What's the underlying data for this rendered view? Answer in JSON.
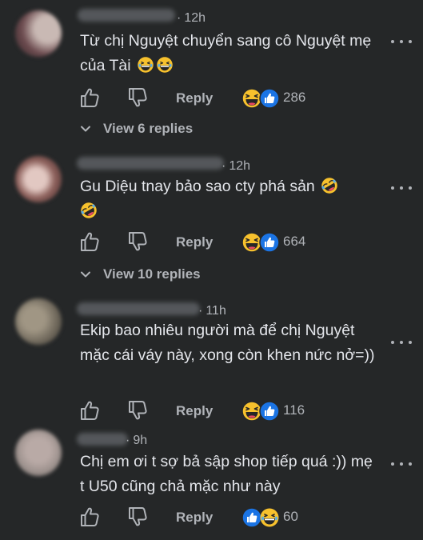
{
  "comments": [
    {
      "time": "12h",
      "text": "Từ chị Nguyệt chuyển sang cô Nguyệt mẹ của Tài",
      "reply_label": "Reply",
      "reaction_count": "286",
      "view_replies": "View 6 replies",
      "avatar_colors": [
        "#6b4a4e",
        "#c9b9b4"
      ]
    },
    {
      "time": "12h",
      "text": "Gu Diệu tnay bảo sao cty phá sản",
      "reply_label": "Reply",
      "reaction_count": "664",
      "view_replies": "View 10 replies",
      "avatar_colors": [
        "#e2c8c2",
        "#4a2f2f"
      ]
    },
    {
      "time": "11h",
      "text": "Ekip bao nhiêu người mà để chị Nguyệt mặc cái váy này, xong còn khen nức nở=))",
      "reply_label": "Reply",
      "reaction_count": "116",
      "avatar_colors": [
        "#8c8272",
        "#6a6357"
      ]
    },
    {
      "time": "9h",
      "text": "Chị em ơi t sợ bả sập shop tiếp quá :)) mẹ t U50 cũng chả mặc như này",
      "reply_label": "Reply",
      "reaction_count": "60",
      "avatar_colors": [
        "#9a8f8b",
        "#b9aaa6"
      ]
    }
  ],
  "icons": {
    "like": "thumbs-up-icon",
    "dislike": "thumbs-down-icon",
    "more": "more-options-icon",
    "laugh": "haha-reaction-icon",
    "like_reaction": "like-reaction-icon",
    "chevron": "chevron-down-icon"
  },
  "colors": {
    "background": "#252728",
    "text": "#e4e6eb",
    "secondary": "#b0b3b8",
    "like_blue": "#1b74e4",
    "emoji_yellow": "#f7c12d"
  }
}
